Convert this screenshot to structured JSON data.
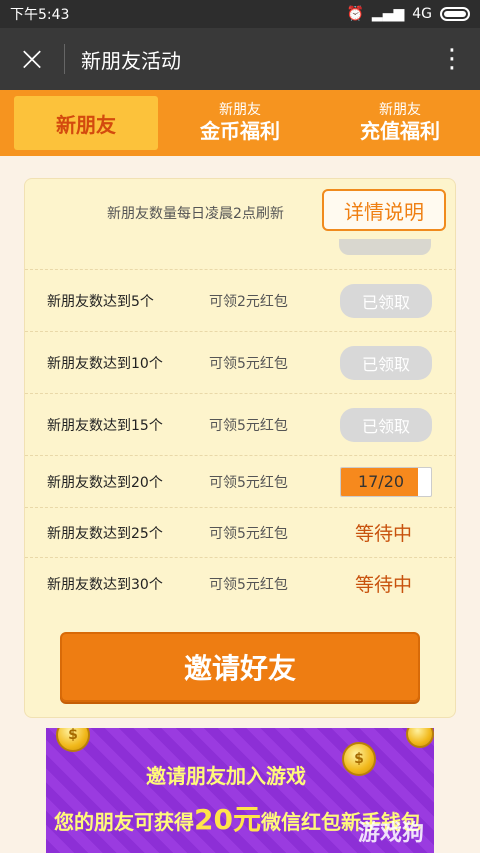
{
  "status_bar": {
    "time": "下午5:43",
    "network": "4G"
  },
  "app_bar": {
    "close_icon": "×",
    "title": "新朋友活动",
    "more_icon": "⋮"
  },
  "tabs": [
    {
      "sub": "",
      "main": "新朋友"
    },
    {
      "sub": "新朋友",
      "main": "金币福利"
    },
    {
      "sub": "新朋友",
      "main": "充值福利"
    }
  ],
  "card": {
    "note": "新朋友数量每日凌晨2点刷新",
    "detail_button": "详情说明",
    "rows": [
      {
        "condition": "新朋友数达到5个",
        "reward": "可领2元红包",
        "state": "已领取"
      },
      {
        "condition": "新朋友数达到10个",
        "reward": "可领5元红包",
        "state": "已领取"
      },
      {
        "condition": "新朋友数达到15个",
        "reward": "可领5元红包",
        "state": "已领取"
      },
      {
        "condition": "新朋友数达到20个",
        "reward": "可领5元红包",
        "progress": "17/20",
        "progress_value": 0.85
      },
      {
        "condition": "新朋友数达到25个",
        "reward": "可领5元红包",
        "state": "等待中"
      },
      {
        "condition": "新朋友数达到30个",
        "reward": "可领5元红包",
        "state": "等待中"
      }
    ]
  },
  "invite_button": "邀请好友",
  "banner": {
    "line1": "邀请朋友加入游戏",
    "line2_prefix": "您的朋友可获得",
    "line2_amount": "20元",
    "line2_suffix": "微信红包新手钱包",
    "watermark": "游戏狗"
  },
  "colors": {
    "tab_bar": "#f6941f",
    "active_tab": "#fcc23b",
    "invite_button": "#ee7d12",
    "card_bg": "#fdf4cc",
    "banner": "#8d2fd6"
  }
}
